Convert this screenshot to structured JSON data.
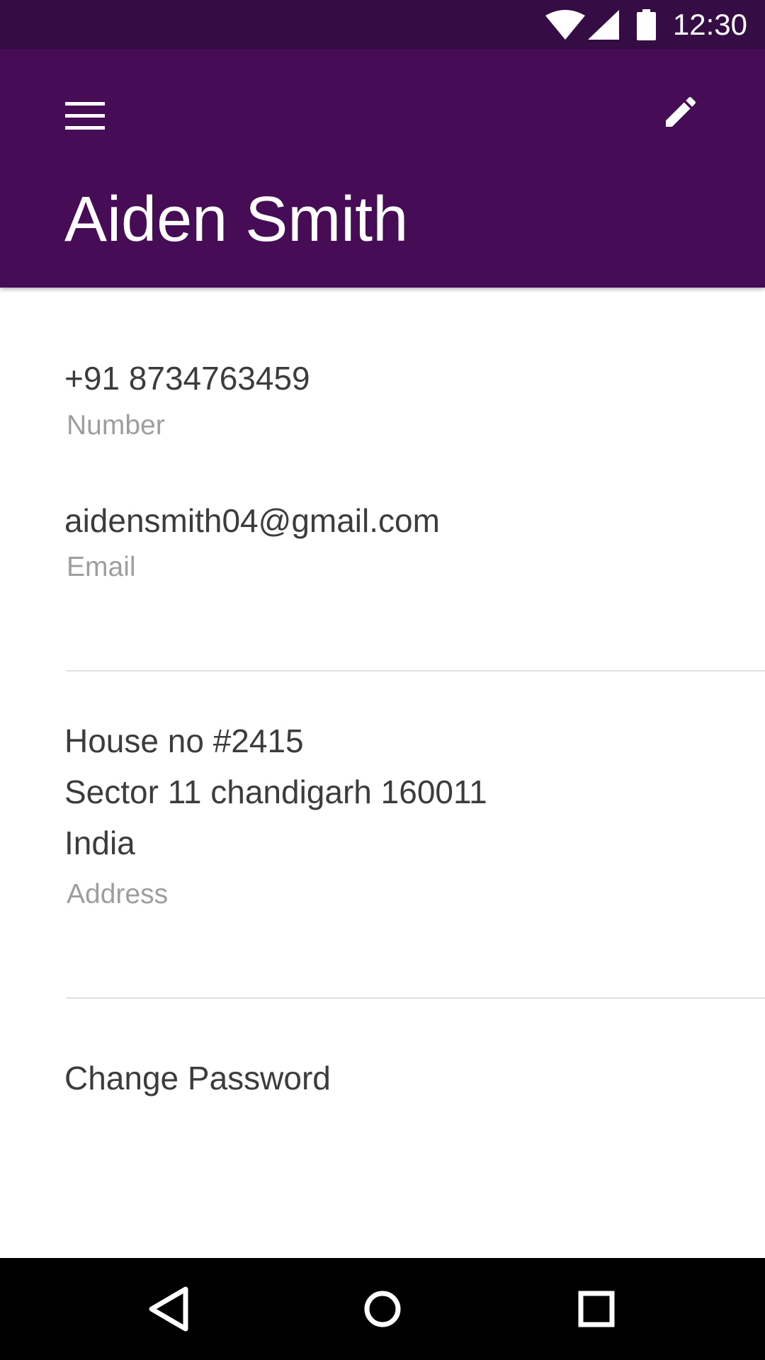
{
  "status_bar": {
    "time": "12:30",
    "icons": [
      "wifi-icon",
      "cell-signal-icon",
      "battery-icon"
    ]
  },
  "app_bar": {
    "title": "Aiden Smith",
    "menu_icon": "hamburger-menu-icon",
    "edit_icon": "pencil-edit-icon",
    "color": "#460d56"
  },
  "profile": {
    "number": {
      "value": "+91 8734763459",
      "label": "Number"
    },
    "email": {
      "value": "aidensmith04@gmail.com",
      "label": "Email"
    },
    "address": {
      "lines": [
        "House no #2415",
        "Sector 11 chandigarh 160011",
        "India"
      ],
      "label": "Address"
    },
    "change_password": "Change Password"
  },
  "nav_bar": {
    "icons": [
      "back-icon",
      "home-icon",
      "recents-icon"
    ]
  }
}
